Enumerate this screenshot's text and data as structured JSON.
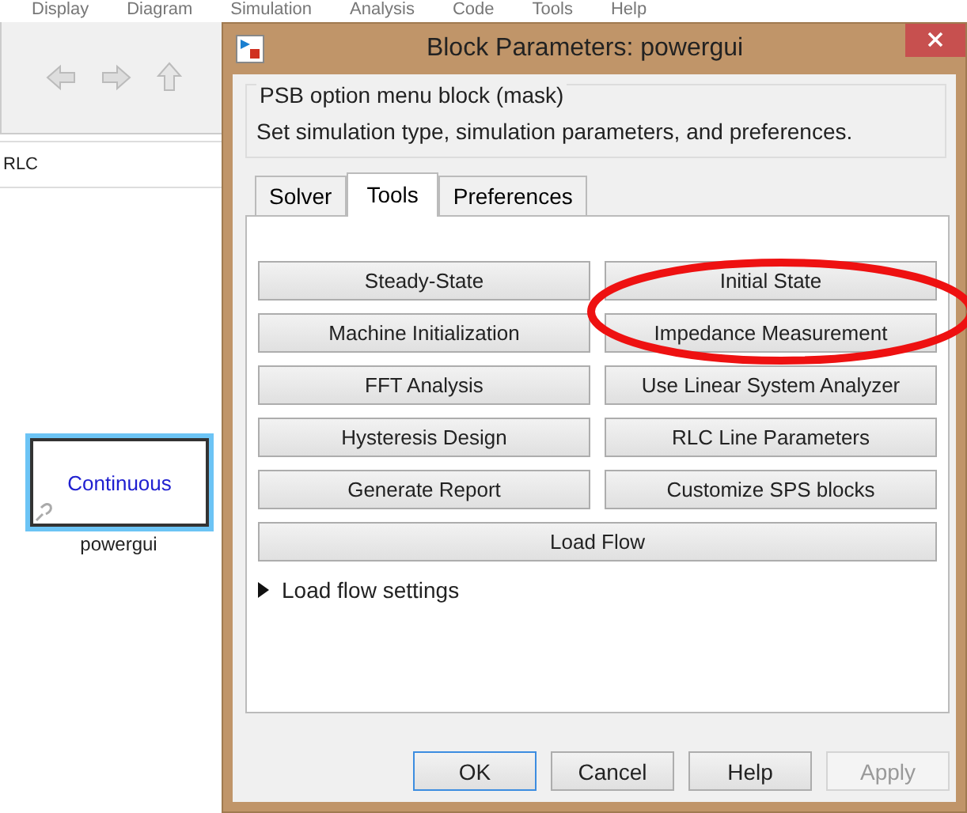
{
  "menu_bar": [
    "Display",
    "Diagram",
    "Simulation",
    "Analysis",
    "Code",
    "Tools",
    "Help"
  ],
  "model": {
    "path": "RLC",
    "block": {
      "label": "Continuous",
      "name": "powergui",
      "selected": true
    }
  },
  "dialog": {
    "title": "Block Parameters: powergui",
    "group_title": "PSB option menu block (mask)",
    "description": "Set simulation type, simulation parameters, and preferences.",
    "tabs": [
      {
        "label": "Solver",
        "selected": false
      },
      {
        "label": "Tools",
        "selected": true
      },
      {
        "label": "Preferences",
        "selected": false
      }
    ],
    "tool_buttons": [
      "Steady-State",
      "Initial State",
      "Machine Initialization",
      "Impedance Measurement",
      "FFT Analysis",
      "Use Linear System Analyzer",
      "Hysteresis Design",
      "RLC Line Parameters",
      "Generate Report",
      "Customize SPS blocks"
    ],
    "wide_button": "Load Flow",
    "section": {
      "label": "Load flow settings",
      "expanded": false
    },
    "buttons": [
      {
        "label": "OK",
        "focused": true,
        "disabled": false
      },
      {
        "label": "Cancel",
        "focused": false,
        "disabled": false
      },
      {
        "label": "Help",
        "focused": false,
        "disabled": false
      },
      {
        "label": "Apply",
        "focused": false,
        "disabled": true
      }
    ]
  }
}
